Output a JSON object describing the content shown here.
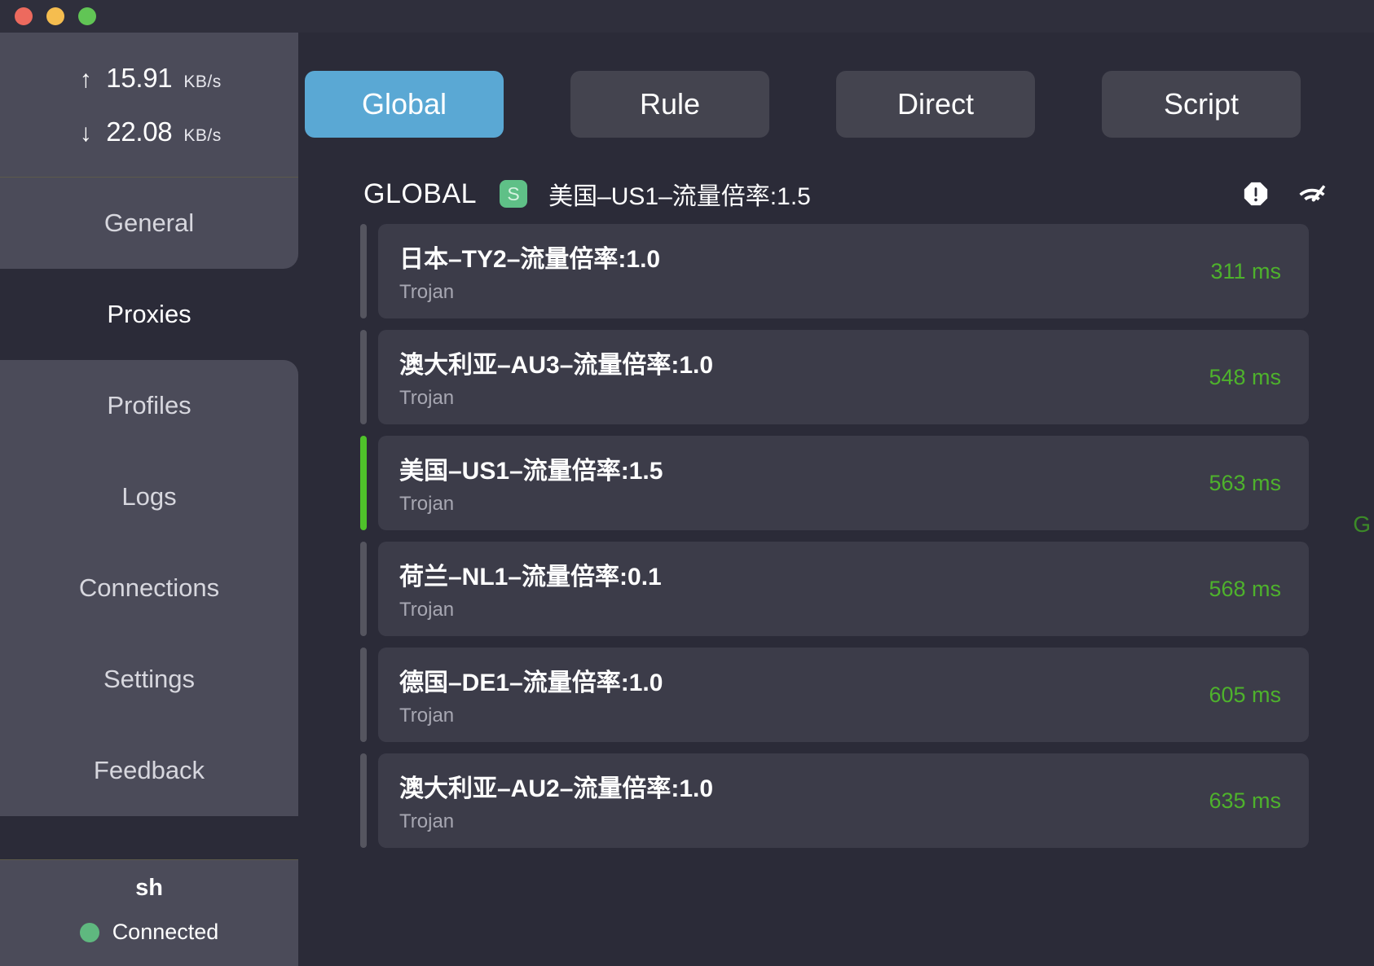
{
  "window": {
    "controls": [
      {
        "name": "close",
        "color": "#ed6a5e"
      },
      {
        "name": "minimize",
        "color": "#f5bd4f"
      },
      {
        "name": "maximize",
        "color": "#61c555"
      }
    ]
  },
  "sidebar": {
    "traffic": {
      "upload": {
        "arrow": "↑",
        "value": "15.91",
        "unit": "KB/s"
      },
      "download": {
        "arrow": "↓",
        "value": "22.08",
        "unit": "KB/s"
      }
    },
    "items": [
      {
        "label": "General",
        "active": false
      },
      {
        "label": "Proxies",
        "active": true
      },
      {
        "label": "Profiles",
        "active": false
      },
      {
        "label": "Logs",
        "active": false
      },
      {
        "label": "Connections",
        "active": false
      },
      {
        "label": "Settings",
        "active": false
      },
      {
        "label": "Feedback",
        "active": false
      }
    ],
    "profile": {
      "name": "sh",
      "status": "Connected",
      "status_color": "#5fb87f"
    }
  },
  "main": {
    "mode_tabs": [
      {
        "label": "Global",
        "active": true
      },
      {
        "label": "Rule",
        "active": false
      },
      {
        "label": "Direct",
        "active": false
      },
      {
        "label": "Script",
        "active": false
      }
    ],
    "group": {
      "title": "GLOBAL",
      "badge": "S",
      "badge_color": "#5fc087",
      "current": "美国–US1–流量倍率:1.5",
      "icons": [
        "warning-octagon-icon",
        "speedtest-icon"
      ]
    },
    "edge_letter": "G",
    "proxies": [
      {
        "name": "日本–TY2–流量倍率:1.0",
        "type": "Trojan",
        "latency": "311 ms",
        "selected": false
      },
      {
        "name": "澳大利亚–AU3–流量倍率:1.0",
        "type": "Trojan",
        "latency": "548 ms",
        "selected": false
      },
      {
        "name": "美国–US1–流量倍率:1.5",
        "type": "Trojan",
        "latency": "563 ms",
        "selected": true
      },
      {
        "name": "荷兰–NL1–流量倍率:0.1",
        "type": "Trojan",
        "latency": "568 ms",
        "selected": false
      },
      {
        "name": "德国–DE1–流量倍率:1.0",
        "type": "Trojan",
        "latency": "605 ms",
        "selected": false
      },
      {
        "name": "澳大利亚–AU2–流量倍率:1.0",
        "type": "Trojan",
        "latency": "635 ms",
        "selected": false
      }
    ]
  },
  "colors": {
    "window_bg": "#2b2b38",
    "sidebar_panel": "#4b4b59",
    "accent_active_tab": "#5aa8d4",
    "latency_green": "#4eb22c",
    "selected_accent": "#4fc22a",
    "card_bg": "#3c3c49"
  }
}
